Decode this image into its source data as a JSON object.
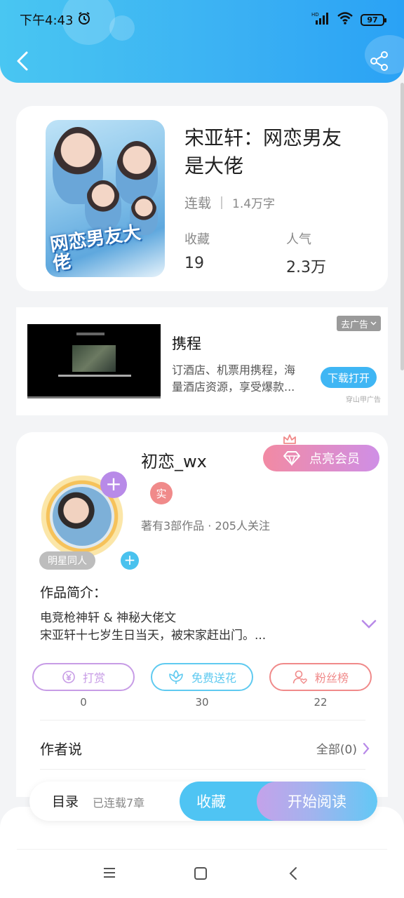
{
  "status_bar": {
    "time": "下午4:43",
    "network": "HD",
    "battery": "97"
  },
  "book": {
    "title": "宋亚轩：网恋男友是大佬",
    "cover_title": "网恋男友大佬",
    "status": "连载",
    "word_count": "1.4万字",
    "favorites_label": "收藏",
    "favorites_value": "19",
    "popularity_label": "人气",
    "popularity_value": "2.3万"
  },
  "ad": {
    "close_label": "去广告",
    "name": "携程",
    "description": "订酒店、机票用携程，海量酒店资源，享受爆款...",
    "button_label": "下载打开",
    "source": "穿山甲广告"
  },
  "author": {
    "name": "初恋_wx",
    "vip_label": "点亮会员",
    "real_badge": "实",
    "stats": "著有3部作品 · 205人关注",
    "tag": "明星同人",
    "intro_title": "作品简介：",
    "intro_line1": "电竞枪神轩 & 神秘大佬文",
    "intro_line2": "宋亚轩十七岁生日当天，被宋家赶出门。...",
    "tip_label": "打赏",
    "tip_count": "0",
    "flower_label": "免费送花",
    "flower_count": "30",
    "fans_label": "粉丝榜",
    "fans_count": "22",
    "author_say_label": "作者说",
    "author_say_all": "全部(0)"
  },
  "bottom_bar": {
    "toc_label": "目录",
    "toc_sub": "已连载7章",
    "fav_label": "收藏",
    "read_label": "开始阅读"
  },
  "colors": {
    "header": "#3ab0f3",
    "accent_blue": "#4fc4f3",
    "purple": "#b88ae8",
    "pink": "#f08a8a",
    "vip_gradient_start": "#f28aa3",
    "vip_gradient_end": "#cf8fe6"
  }
}
